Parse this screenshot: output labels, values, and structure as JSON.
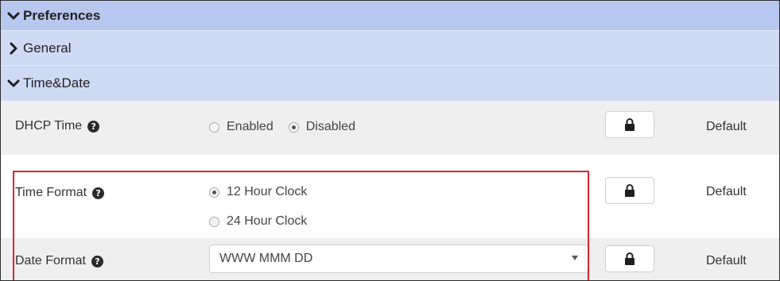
{
  "sections": {
    "preferences": {
      "label": "Preferences",
      "expanded": true
    },
    "general": {
      "label": "General",
      "expanded": false
    },
    "time_date": {
      "label": "Time&Date",
      "expanded": true
    }
  },
  "rows": {
    "dhcp_time": {
      "label": "DHCP Time",
      "options": [
        {
          "label": "Enabled",
          "checked": false
        },
        {
          "label": "Disabled",
          "checked": true
        }
      ],
      "default_label": "Default"
    },
    "time_format": {
      "label": "Time Format",
      "options": [
        {
          "label": "12 Hour Clock",
          "checked": true
        },
        {
          "label": "24 Hour Clock",
          "checked": false
        }
      ],
      "default_label": "Default"
    },
    "date_format": {
      "label": "Date Format",
      "selected_value": "WWW MMM DD",
      "default_label": "Default"
    }
  },
  "icons": {
    "help": "help-icon",
    "lock": "lock-icon",
    "chevron_down": "chevron-down-icon",
    "chevron_right": "chevron-right-icon"
  },
  "colors": {
    "preferences_header": "#b7c7ef",
    "subsection_header": "#cfdaf4",
    "row_alt": "#efefef",
    "highlight_border": "#e0242b"
  }
}
